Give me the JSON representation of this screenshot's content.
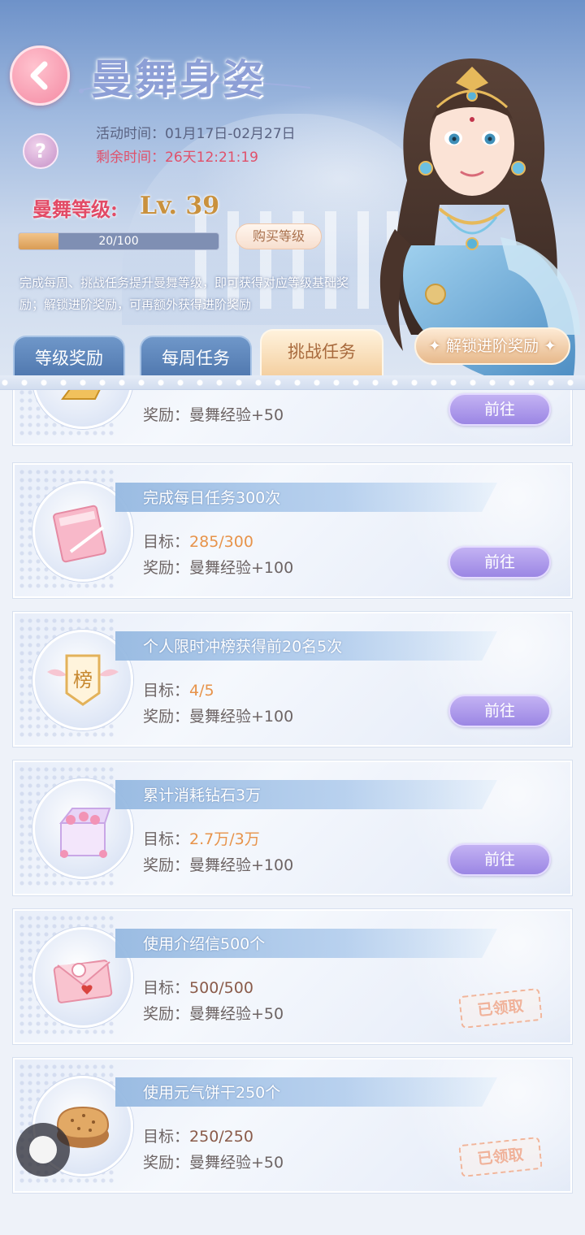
{
  "header": {
    "title": "曼舞身姿",
    "event_time_label": "活动时间：",
    "event_time_value": "01月17日-02月27日",
    "remaining_label": "剩余时间：",
    "remaining_value": "26天12:21:19",
    "level_label": "曼舞等级:",
    "level_value": "Lv. 39",
    "progress_text": "20/100",
    "progress_fraction": 0.2,
    "buy_level_label": "购买等级",
    "description": "完成每周、挑战任务提升曼舞等级，即可获得对应等级基础奖励；解锁进阶奖励，可再额外获得进阶奖励",
    "unlock_label": "解锁进阶奖励"
  },
  "tabs": [
    {
      "label": "等级奖励",
      "active": false
    },
    {
      "label": "每周任务",
      "active": false
    },
    {
      "label": "挑战任务",
      "active": true
    }
  ],
  "tasks": [
    {
      "title": "",
      "goal_label": "",
      "goal_value": "",
      "reward_label": "奖励：",
      "reward_value": "曼舞经验+50",
      "action": "前往",
      "status": "go",
      "icon": "gold-bar-icon"
    },
    {
      "title": "完成每日任务300次",
      "goal_label": "目标：",
      "goal_value": "285/300",
      "reward_label": "奖励：",
      "reward_value": "曼舞经验+100",
      "action": "前往",
      "status": "go",
      "icon": "task-book-icon"
    },
    {
      "title": "个人限时冲榜获得前20名5次",
      "goal_label": "目标：",
      "goal_value": "4/5",
      "reward_label": "奖励：",
      "reward_value": "曼舞经验+100",
      "action": "前往",
      "status": "go",
      "icon": "ranking-badge-icon",
      "icon_text": "榜"
    },
    {
      "title": "累计消耗钻石3万",
      "goal_label": "目标：",
      "goal_value": "2.7万/3万",
      "reward_label": "奖励：",
      "reward_value": "曼舞经验+100",
      "action": "前往",
      "status": "go",
      "icon": "gift-box-icon"
    },
    {
      "title": "使用介绍信500个",
      "goal_label": "目标：",
      "goal_value": "500/500",
      "reward_label": "奖励：",
      "reward_value": "曼舞经验+50",
      "action": "已领取",
      "status": "claimed",
      "icon": "envelope-icon"
    },
    {
      "title": "使用元气饼干250个",
      "goal_label": "目标：",
      "goal_value": "250/250",
      "reward_label": "奖励：",
      "reward_value": "曼舞经验+50",
      "action": "已领取",
      "status": "claimed",
      "icon": "cookie-icon"
    }
  ],
  "colors": {
    "accent_pink": "#e24b66",
    "level_gold": "#c9913d",
    "go_button": "#9b86e4",
    "goal_orange": "#e7934a",
    "claimed_stamp": "#f0b29a"
  }
}
